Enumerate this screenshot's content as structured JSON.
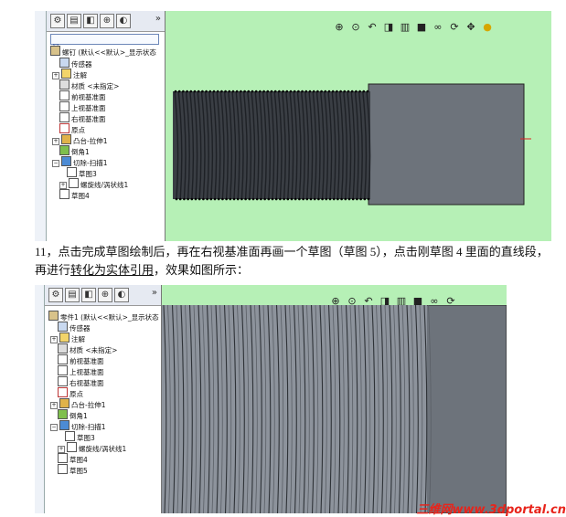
{
  "shot1": {
    "tree": {
      "root": "螺钉   (默认<<默认>_显示状态",
      "items": [
        {
          "label": "传感器"
        },
        {
          "label": "注解"
        },
        {
          "label": "材质 <未指定>"
        },
        {
          "label": "前视基准面"
        },
        {
          "label": "上视基准面"
        },
        {
          "label": "右视基准面"
        },
        {
          "label": "原点"
        },
        {
          "label": "凸台-拉伸1"
        },
        {
          "label": "倒角1"
        },
        {
          "label": "切除-扫描1"
        },
        {
          "label": "草图3"
        },
        {
          "label": "螺旋线/涡状线1"
        },
        {
          "label": "草图4"
        }
      ]
    }
  },
  "paragraph": {
    "part1": "11，点击完成草图绘制后，再在右视基准面再画一个草图（草图 5），点击刚草图 4 里面的直线段，再进行",
    "link": "转化为实体引用",
    "part2": "，效果如图所示："
  },
  "shot2": {
    "tree": {
      "root": "零件1   (默认<<默认>_显示状态",
      "items": [
        {
          "label": "传感器"
        },
        {
          "label": "注解"
        },
        {
          "label": "材质 <未指定>"
        },
        {
          "label": "前视基准面"
        },
        {
          "label": "上视基准面"
        },
        {
          "label": "右视基准面"
        },
        {
          "label": "原点"
        },
        {
          "label": "凸台-拉伸1"
        },
        {
          "label": "倒角1"
        },
        {
          "label": "切除-扫描1"
        },
        {
          "label": "草图3"
        },
        {
          "label": "螺旋线/涡状线1"
        },
        {
          "label": "草图4"
        },
        {
          "label": "草图5"
        }
      ]
    }
  },
  "watermark": "三维网www.3dportal.cn",
  "tabs_more": "»",
  "icons": [
    "feature-manager-icon",
    "property-manager-icon",
    "configuration-manager-icon",
    "dimxpert-icon",
    "display-manager-icon",
    "filter-icon",
    "zoom-fit-icon",
    "zoom-area-icon",
    "section-view-icon",
    "rotate-icon",
    "pan-icon"
  ],
  "colors": {
    "viewport_bg": "#b6f0b6",
    "model": "#6d737b",
    "thread_dark": "#2b2e33",
    "watermark": "#e8241b"
  }
}
